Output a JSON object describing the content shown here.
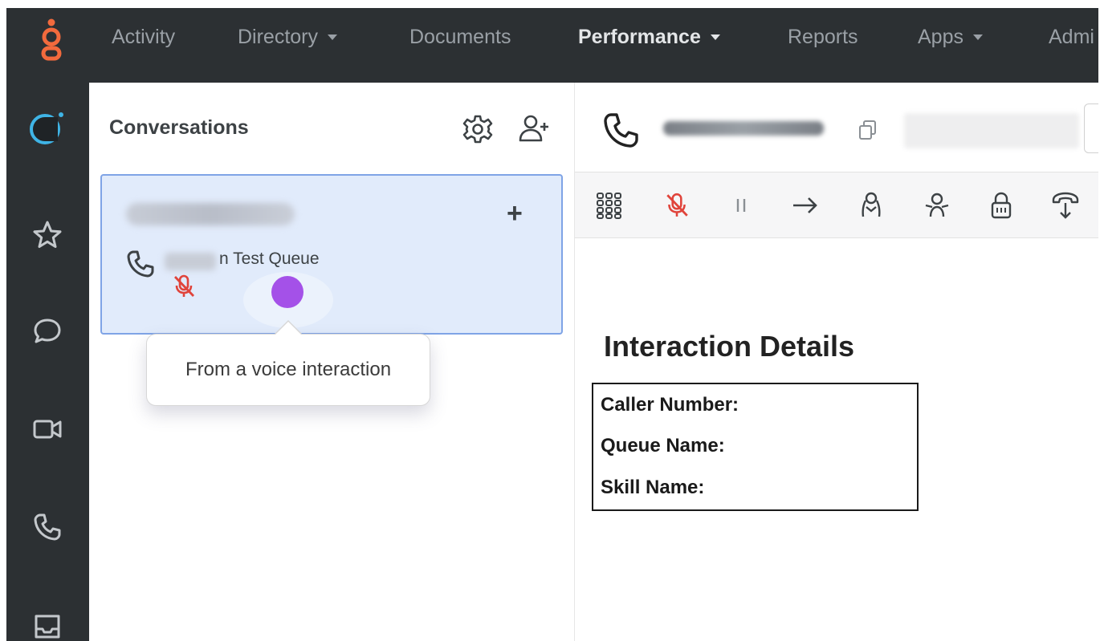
{
  "topnav": {
    "logo_icon": "genesys-logo-icon",
    "items": [
      {
        "label": "Activity",
        "has_caret": false,
        "active": false
      },
      {
        "label": "Directory",
        "has_caret": true,
        "active": false
      },
      {
        "label": "Documents",
        "has_caret": false,
        "active": false
      },
      {
        "label": "Performance",
        "has_caret": true,
        "active": true
      },
      {
        "label": "Reports",
        "has_caret": false,
        "active": false
      },
      {
        "label": "Apps",
        "has_caret": true,
        "active": false
      },
      {
        "label": "Admi",
        "has_caret": false,
        "active": false
      }
    ]
  },
  "sidebar": {
    "items": [
      {
        "icon": "status-ring-icon"
      },
      {
        "icon": "star-icon"
      },
      {
        "icon": "chat-bubble-icon"
      },
      {
        "icon": "video-icon"
      },
      {
        "icon": "phone-icon"
      },
      {
        "icon": "inbox-icon"
      }
    ]
  },
  "conversations": {
    "title": "Conversations",
    "settings_icon": "gear-icon",
    "add_participant_icon": "add-user-icon",
    "card": {
      "add_label": "+",
      "queue_text": "n Test Queue",
      "phone_icon": "phone-icon",
      "muted_icon": "mic-off-icon"
    },
    "tooltip": {
      "text": "From a voice interaction"
    }
  },
  "interaction": {
    "header": {
      "phone_icon": "phone-icon",
      "copy_icon": "copy-icon"
    },
    "toolbar": [
      {
        "icon": "dialpad-icon"
      },
      {
        "icon": "mic-off-icon"
      },
      {
        "icon": "pause-icon"
      },
      {
        "icon": "transfer-arrow-icon"
      },
      {
        "icon": "consult-icon"
      },
      {
        "icon": "conference-icon"
      },
      {
        "icon": "secure-lock-icon"
      },
      {
        "icon": "hang-up-icon"
      }
    ],
    "details": {
      "title": "Interaction Details",
      "rows": [
        {
          "label": "Caller Number:"
        },
        {
          "label": "Queue Name:"
        },
        {
          "label": "Skill Name:"
        }
      ]
    }
  },
  "colors": {
    "nav_bg": "#2c3033",
    "accent_orange": "#f26a3d",
    "card_bg": "#e1ebfb",
    "card_border": "#7fa4e6",
    "presence_dot": "#a451e8",
    "muted_red": "#e0443b",
    "ring_blue": "#3fb4e6"
  }
}
